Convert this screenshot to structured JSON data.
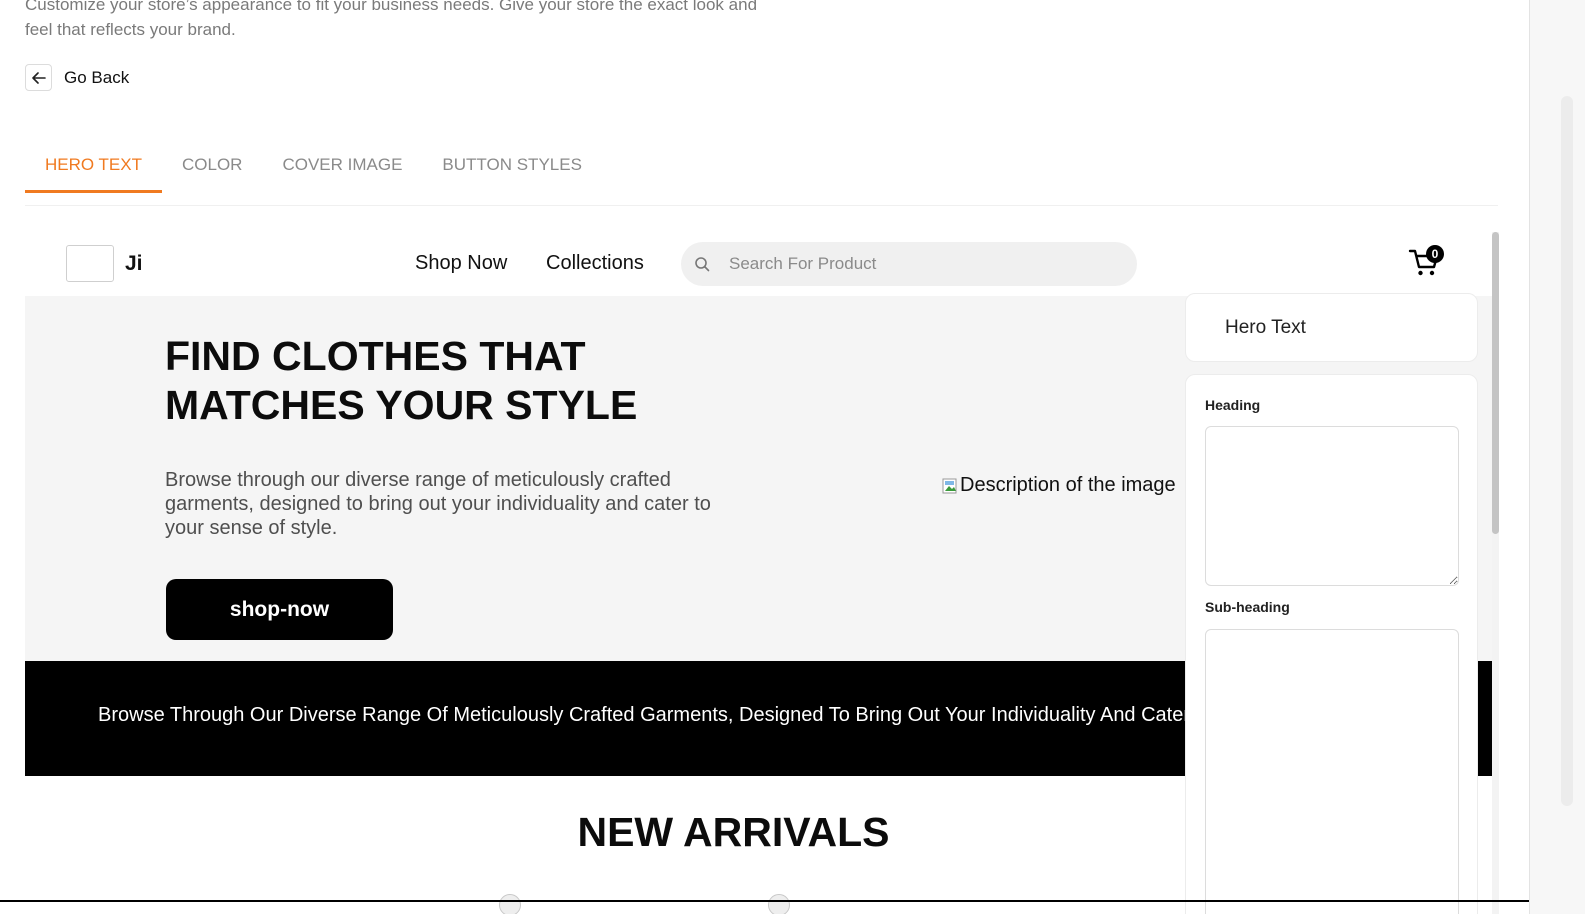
{
  "page": {
    "description": "Customize your store’s appearance to fit your business needs. Give your store the exact look and feel that reflects your brand.",
    "go_back_label": "Go Back",
    "go_back_icon": "arrow-left-icon"
  },
  "tabs": [
    {
      "label": "HERO TEXT",
      "active": true
    },
    {
      "label": "COLOR",
      "active": false
    },
    {
      "label": "COVER IMAGE",
      "active": false
    },
    {
      "label": "BUTTON STYLES",
      "active": false
    }
  ],
  "colors": {
    "accent": "#f07a20",
    "banner_bg": "#000000",
    "hero_bg": "#f5f5f5"
  },
  "store": {
    "brand": "Ji",
    "nav": {
      "shop_now": "Shop Now",
      "collections": "Collections"
    },
    "search_placeholder": "Search For Product",
    "cart_count": "0",
    "hero": {
      "title": "FIND CLOTHES THAT MATCHES YOUR STYLE",
      "subtitle": "Browse through our diverse range of meticulously crafted garments, designed to bring out your individuality and cater to your sense of style.",
      "button_label": "shop-now",
      "image_alt": "Description of the image"
    },
    "banner_text": "Browse Through Our Diverse Range Of Meticulously Crafted Garments, Designed To Bring Out Your Individuality And Cater To Your Sense Of Style.",
    "new_arrivals_title": "NEW ARRIVALS"
  },
  "panel": {
    "title": "Hero Text",
    "heading_label": "Heading",
    "heading_value": "",
    "subheading_label": "Sub-heading",
    "subheading_value": ""
  }
}
